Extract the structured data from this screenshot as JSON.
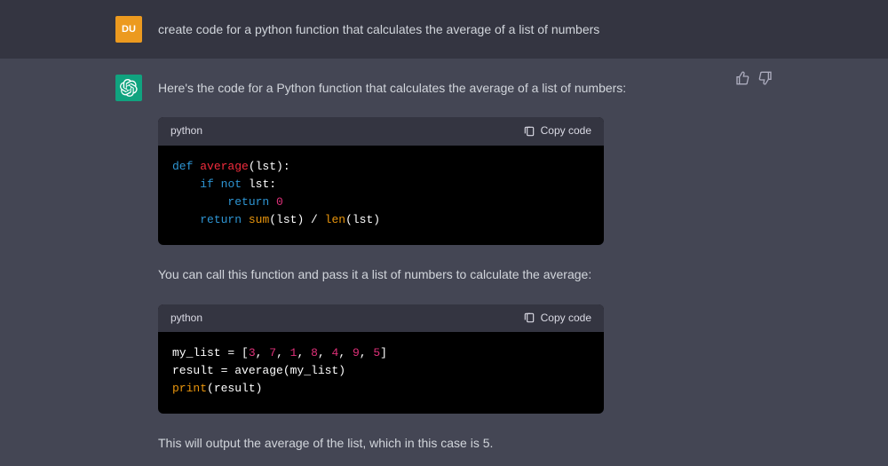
{
  "user": {
    "avatar_initials": "DU",
    "prompt": "create code for a python function that calculates the average of a list of numbers"
  },
  "assistant": {
    "intro": "Here's the code for a Python function that calculates the average of a list of numbers:",
    "code1": {
      "lang_label": "python",
      "copy_label": "Copy code",
      "tokens": {
        "def": "def",
        "fn_name": "average",
        "lparen": "(lst):",
        "if": "if",
        "not": "not",
        "lst_colon": " lst:",
        "return1": "return",
        "zero": "0",
        "return2": "return",
        "sum": "sum",
        "sum_arg": "(lst) / ",
        "len": "len",
        "len_arg": "(lst)"
      }
    },
    "para2": "You can call this function and pass it a list of numbers to calculate the average:",
    "code2": {
      "lang_label": "python",
      "copy_label": "Copy code",
      "tokens": {
        "mylist": "my_list = [",
        "nums": [
          "3",
          "7",
          "1",
          "8",
          "4",
          "9",
          "5"
        ],
        "close": "]",
        "result_line": "result = average(my_list)",
        "print": "print",
        "print_arg": "(result)"
      }
    },
    "para3": "This will output the average of the list, which in this case is 5."
  }
}
